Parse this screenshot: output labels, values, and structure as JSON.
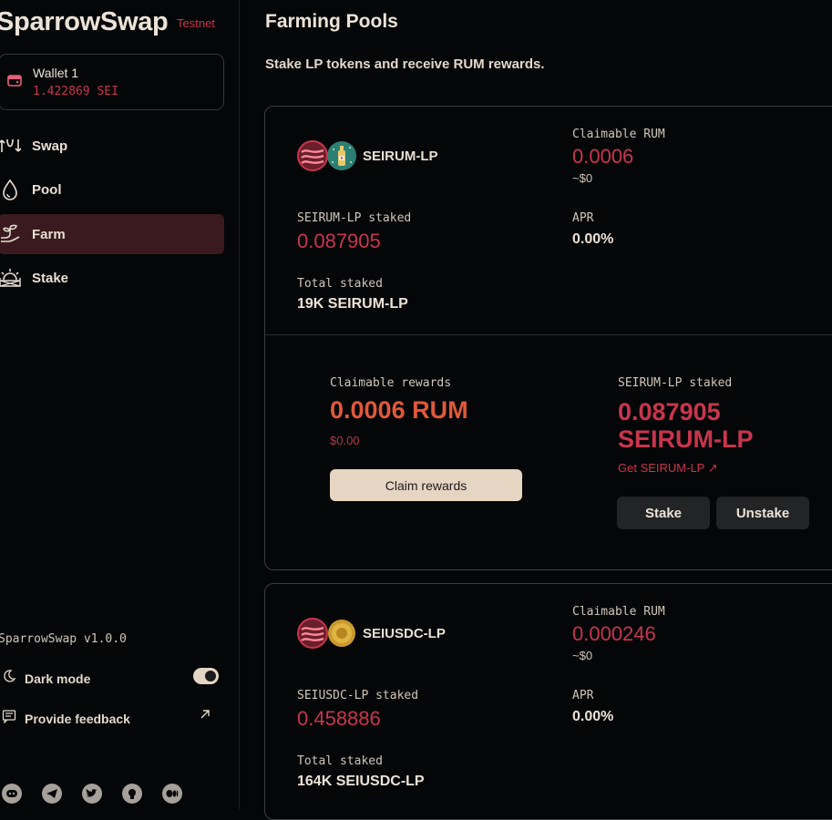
{
  "app": {
    "name": "SparrowSwap",
    "network": "Testnet",
    "version": "SparrowSwap v1.0.0"
  },
  "wallet": {
    "name": "Wallet 1",
    "balance": "1.422869 SEI"
  },
  "nav": [
    {
      "label": "Swap",
      "icon": "swap-icon"
    },
    {
      "label": "Pool",
      "icon": "drop-icon"
    },
    {
      "label": "Farm",
      "icon": "plant-icon",
      "active": true
    },
    {
      "label": "Stake",
      "icon": "sunrise-icon"
    }
  ],
  "settings": {
    "dark_mode": "Dark mode",
    "dark_mode_on": true,
    "feedback": "Provide feedback"
  },
  "socials": [
    "discord-icon",
    "telegram-icon",
    "twitter-icon",
    "github-icon",
    "medium-icon"
  ],
  "page": {
    "title": "Farming Pools",
    "subtitle": "Stake LP tokens and receive RUM rewards."
  },
  "pools": [
    {
      "pair": "SEIRUM-LP",
      "claimable_label": "Claimable RUM",
      "claimable_value": "0.0006",
      "claimable_usd": "~$0",
      "staked_label": "SEIRUM-LP staked",
      "staked_value": "0.087905",
      "apr_label": "APR",
      "apr_value": "0.00%",
      "total_label": "Total staked",
      "total_value": "19K SEIRUM-LP",
      "expanded": {
        "rewards_label": "Claimable rewards",
        "rewards_value": "0.0006 RUM",
        "rewards_usd": "$0.00",
        "claim_button": "Claim rewards",
        "staked_label": "SEIRUM-LP staked",
        "staked_value_line1": "0.087905",
        "staked_value_line2": "SEIRUM-LP",
        "get_link": "Get SEIRUM-LP ↗",
        "stake_button": "Stake",
        "unstake_button": "Unstake"
      }
    },
    {
      "pair": "SEIUSDC-LP",
      "claimable_label": "Claimable RUM",
      "claimable_value": "0.000246",
      "claimable_usd": "~$0",
      "staked_label": "SEIUSDC-LP staked",
      "staked_value": "0.458886",
      "apr_label": "APR",
      "apr_value": "0.00%",
      "total_label": "Total staked",
      "total_value": "164K SEIUSDC-LP"
    }
  ],
  "colors": {
    "accent_red": "#c9354e",
    "accent_orange": "#e0593b",
    "active_nav": "#3a1a1f",
    "claim_button": "#e6d5c2"
  }
}
